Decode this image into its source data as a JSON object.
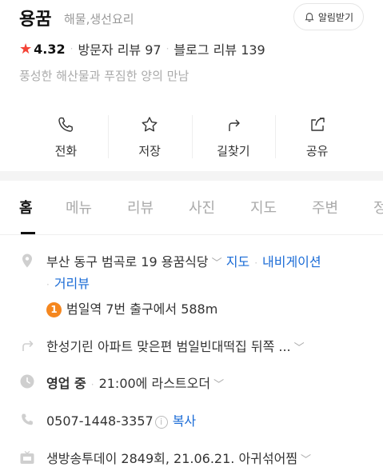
{
  "place": {
    "name": "용꿈",
    "category": "해물,생선요리",
    "alarm_label": "알림받기",
    "rating": "4.32",
    "visitor_reviews": "방문자 리뷰 97",
    "blog_reviews": "블로그 리뷰 139",
    "description": "풍성한 해산물과 푸짐한 양의 만남"
  },
  "actions": [
    {
      "label": "전화",
      "icon": "phone-icon"
    },
    {
      "label": "저장",
      "icon": "star-icon"
    },
    {
      "label": "길찾기",
      "icon": "directions-icon"
    },
    {
      "label": "공유",
      "icon": "share-icon"
    }
  ],
  "tabs": [
    "홈",
    "메뉴",
    "리뷰",
    "사진",
    "지도",
    "주변",
    "정"
  ],
  "info": {
    "address": "부산 동구 범곡로 19 용꿈식당",
    "map_link": "지도",
    "navi_link": "내비게이션",
    "distance_link": "거리뷰",
    "subway_badge": "1",
    "subway_text": "범일역 7번 출구에서 588m",
    "directions_text": "한성기린 아파트 맞은편 범일빈대떡집 뒤쪽 ...",
    "hours_status": "영업 중",
    "hours_text": "21:00에 라스트오더",
    "phone": "0507-1448-3357",
    "copy_label": "복사",
    "tv_text": "생방송투데이 2849회, 21.06.21. 아귀섞어찜"
  },
  "colors": {
    "accent_link": "#1a6bd6",
    "rating_star": "#f44336",
    "subway_line1": "#f5871f"
  }
}
